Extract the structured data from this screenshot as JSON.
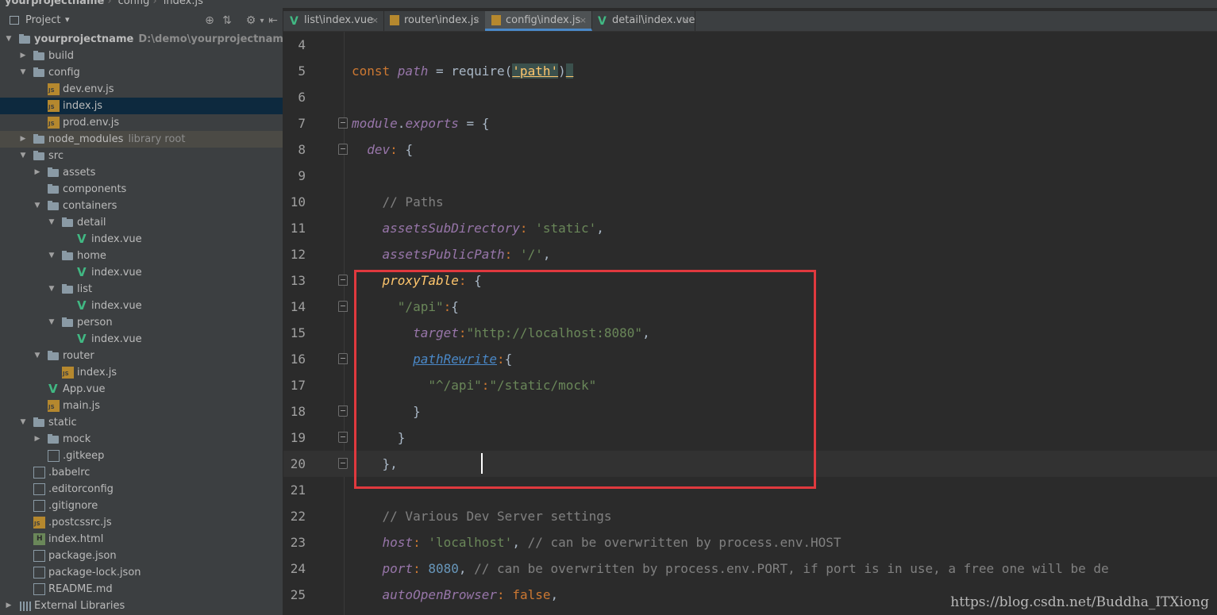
{
  "breadcrumb": [
    "yourprojectname",
    "config",
    "index.js"
  ],
  "sidebar": {
    "title": "Project",
    "tree": [
      {
        "label": "yourprojectname",
        "sub": "D:\\demo\\yourprojectname",
        "icon": "folder",
        "arrow": "open",
        "depth": 0,
        "bold": true
      },
      {
        "label": "build",
        "icon": "folder",
        "arrow": "closed",
        "depth": 1
      },
      {
        "label": "config",
        "icon": "folder",
        "arrow": "open",
        "depth": 1
      },
      {
        "label": "dev.env.js",
        "icon": "js",
        "depth": 2
      },
      {
        "label": "index.js",
        "icon": "js",
        "depth": 2,
        "selected": true
      },
      {
        "label": "prod.env.js",
        "icon": "js",
        "depth": 2
      },
      {
        "label": "node_modules",
        "sub": "library root",
        "icon": "folder",
        "arrow": "closed",
        "depth": 1,
        "library": true
      },
      {
        "label": "src",
        "icon": "folder",
        "arrow": "open",
        "depth": 1
      },
      {
        "label": "assets",
        "icon": "folder",
        "arrow": "closed",
        "depth": 2
      },
      {
        "label": "components",
        "icon": "folder",
        "depth": 2
      },
      {
        "label": "containers",
        "icon": "folder",
        "arrow": "open",
        "depth": 2
      },
      {
        "label": "detail",
        "icon": "folder",
        "arrow": "open",
        "depth": 3
      },
      {
        "label": "index.vue",
        "icon": "vue",
        "depth": 4
      },
      {
        "label": "home",
        "icon": "folder",
        "arrow": "open",
        "depth": 3
      },
      {
        "label": "index.vue",
        "icon": "vue",
        "depth": 4
      },
      {
        "label": "list",
        "icon": "folder",
        "arrow": "open",
        "depth": 3
      },
      {
        "label": "index.vue",
        "icon": "vue",
        "depth": 4
      },
      {
        "label": "person",
        "icon": "folder",
        "arrow": "open",
        "depth": 3
      },
      {
        "label": "index.vue",
        "icon": "vue",
        "depth": 4
      },
      {
        "label": "router",
        "icon": "folder",
        "arrow": "open",
        "depth": 2
      },
      {
        "label": "index.js",
        "icon": "js",
        "depth": 3
      },
      {
        "label": "App.vue",
        "icon": "vue",
        "depth": 2
      },
      {
        "label": "main.js",
        "icon": "js",
        "depth": 2
      },
      {
        "label": "static",
        "icon": "folder",
        "arrow": "open",
        "depth": 1
      },
      {
        "label": "mock",
        "icon": "folder",
        "arrow": "closed",
        "depth": 2
      },
      {
        "label": ".gitkeep",
        "icon": "file",
        "depth": 2
      },
      {
        "label": ".babelrc",
        "icon": "file",
        "depth": 1
      },
      {
        "label": ".editorconfig",
        "icon": "file",
        "depth": 1
      },
      {
        "label": ".gitignore",
        "icon": "file",
        "depth": 1
      },
      {
        "label": ".postcssrc.js",
        "icon": "js",
        "depth": 1
      },
      {
        "label": "index.html",
        "icon": "html",
        "depth": 1
      },
      {
        "label": "package.json",
        "icon": "file",
        "depth": 1
      },
      {
        "label": "package-lock.json",
        "icon": "file",
        "depth": 1
      },
      {
        "label": "README.md",
        "icon": "file",
        "depth": 1
      },
      {
        "label": "External Libraries",
        "icon": "ext",
        "arrow": "closed",
        "depth": 0
      }
    ]
  },
  "tabs": [
    {
      "label": "list\\index.vue",
      "icon": "vue",
      "active": false
    },
    {
      "label": "router\\index.js",
      "icon": "js",
      "active": false
    },
    {
      "label": "config\\index.js",
      "icon": "js",
      "active": true
    },
    {
      "label": "detail\\index.vue",
      "icon": "vue",
      "active": false
    }
  ],
  "tab_close_glyph": "×",
  "code": [
    {
      "n": "4",
      "segs": []
    },
    {
      "n": "5",
      "segs": [
        [
          "kw",
          "const "
        ],
        [
          "var",
          "path"
        ],
        [
          "plain",
          " = require("
        ],
        [
          "hl",
          "'path'"
        ],
        [
          "plain",
          ")"
        ],
        [
          "hl",
          " "
        ]
      ]
    },
    {
      "n": "6",
      "segs": []
    },
    {
      "n": "7",
      "fold": "start",
      "segs": [
        [
          "var",
          "module"
        ],
        [
          "plain",
          "."
        ],
        [
          "var",
          "exports"
        ],
        [
          "plain",
          " = {"
        ]
      ]
    },
    {
      "n": "8",
      "fold": "start",
      "segs": [
        [
          "plain",
          "  "
        ],
        [
          "prop",
          "dev"
        ],
        [
          "kw",
          ":"
        ],
        [
          "plain",
          " {"
        ]
      ]
    },
    {
      "n": "9",
      "segs": []
    },
    {
      "n": "10",
      "segs": [
        [
          "plain",
          "    "
        ],
        [
          "cmt",
          "// Paths"
        ]
      ]
    },
    {
      "n": "11",
      "segs": [
        [
          "plain",
          "    "
        ],
        [
          "prop",
          "assetsSubDirectory"
        ],
        [
          "kw",
          ":"
        ],
        [
          "plain",
          " "
        ],
        [
          "str",
          "'static'"
        ],
        [
          "plain",
          ","
        ]
      ]
    },
    {
      "n": "12",
      "segs": [
        [
          "plain",
          "    "
        ],
        [
          "prop",
          "assetsPublicPath"
        ],
        [
          "kw",
          ":"
        ],
        [
          "plain",
          " "
        ],
        [
          "str",
          "'/'"
        ],
        [
          "plain",
          ","
        ]
      ]
    },
    {
      "n": "13",
      "fold": "start",
      "segs": [
        [
          "plain",
          "    "
        ],
        [
          "ofield",
          "proxyTable"
        ],
        [
          "kw",
          ":"
        ],
        [
          "plain",
          " {"
        ]
      ]
    },
    {
      "n": "14",
      "fold": "start",
      "segs": [
        [
          "plain",
          "      "
        ],
        [
          "str",
          "\"/api\""
        ],
        [
          "kw",
          ":"
        ],
        [
          "plain",
          "{"
        ]
      ]
    },
    {
      "n": "15",
      "segs": [
        [
          "plain",
          "        "
        ],
        [
          "prop",
          "target"
        ],
        [
          "kw",
          ":"
        ],
        [
          "str",
          "\"http://localhost:8080\""
        ],
        [
          "plain",
          ","
        ]
      ]
    },
    {
      "n": "16",
      "fold": "start",
      "segs": [
        [
          "plain",
          "        "
        ],
        [
          "link",
          "pathRewrite"
        ],
        [
          "kw",
          ":"
        ],
        [
          "plain",
          "{"
        ]
      ]
    },
    {
      "n": "17",
      "segs": [
        [
          "plain",
          "          "
        ],
        [
          "str",
          "\"^/api\""
        ],
        [
          "kw",
          ":"
        ],
        [
          "str",
          "\"/static/mock\""
        ]
      ]
    },
    {
      "n": "18",
      "fold": "end",
      "segs": [
        [
          "plain",
          "        }"
        ]
      ]
    },
    {
      "n": "19",
      "fold": "end",
      "segs": [
        [
          "plain",
          "      }"
        ]
      ]
    },
    {
      "n": "20",
      "fold": "end",
      "current": true,
      "segs": [
        [
          "plain",
          "    },"
        ]
      ]
    },
    {
      "n": "21",
      "segs": []
    },
    {
      "n": "22",
      "segs": [
        [
          "plain",
          "    "
        ],
        [
          "cmt",
          "// Various Dev Server settings"
        ]
      ]
    },
    {
      "n": "23",
      "segs": [
        [
          "plain",
          "    "
        ],
        [
          "prop",
          "host"
        ],
        [
          "kw",
          ":"
        ],
        [
          "plain",
          " "
        ],
        [
          "str",
          "'localhost'"
        ],
        [
          "plain",
          ", "
        ],
        [
          "cmt",
          "// can be overwritten by process.env.HOST"
        ]
      ]
    },
    {
      "n": "24",
      "segs": [
        [
          "plain",
          "    "
        ],
        [
          "prop",
          "port"
        ],
        [
          "kw",
          ":"
        ],
        [
          "plain",
          " "
        ],
        [
          "num",
          "8080"
        ],
        [
          "plain",
          ", "
        ],
        [
          "cmt",
          "// can be overwritten by process.env.PORT, if port is in use, a free one will be de"
        ]
      ]
    },
    {
      "n": "25",
      "segs": [
        [
          "plain",
          "    "
        ],
        [
          "prop",
          "autoOpenBrowser"
        ],
        [
          "kw",
          ":"
        ],
        [
          "plain",
          " "
        ],
        [
          "kw",
          "false"
        ],
        [
          "plain",
          ","
        ]
      ]
    }
  ],
  "watermark": "https://blog.csdn.net/Buddha_ITXiong",
  "colors": {
    "highlight_box": "#e0393e",
    "active_tab_underline": "#4a88c7",
    "selected_row": "#0d293e"
  }
}
